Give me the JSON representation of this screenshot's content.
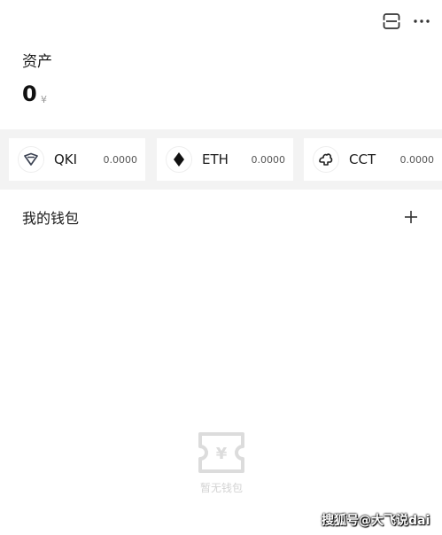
{
  "header": {
    "scan_icon": "scan-icon",
    "more_icon": "more-dots-icon"
  },
  "assets": {
    "title": "资产",
    "total": "0",
    "currency_symbol": "¥"
  },
  "coins": [
    {
      "name": "QKI",
      "amount": "0.0000",
      "icon": "qki-logo-icon"
    },
    {
      "name": "ETH",
      "amount": "0.0000",
      "icon": "eth-logo-icon"
    },
    {
      "name": "CCT",
      "amount": "0.0000",
      "icon": "cct-logo-icon"
    }
  ],
  "wallets": {
    "title": "我的钱包",
    "add_icon": "plus-icon",
    "empty_text": "暂无钱包",
    "empty_icon": "empty-wallet-ticket-icon"
  },
  "watermark": "搜狐号@大飞说dai",
  "colors": {
    "background": "#ffffff",
    "strip_background": "#f3f3f3",
    "empty_state": "#d3d3d3"
  }
}
